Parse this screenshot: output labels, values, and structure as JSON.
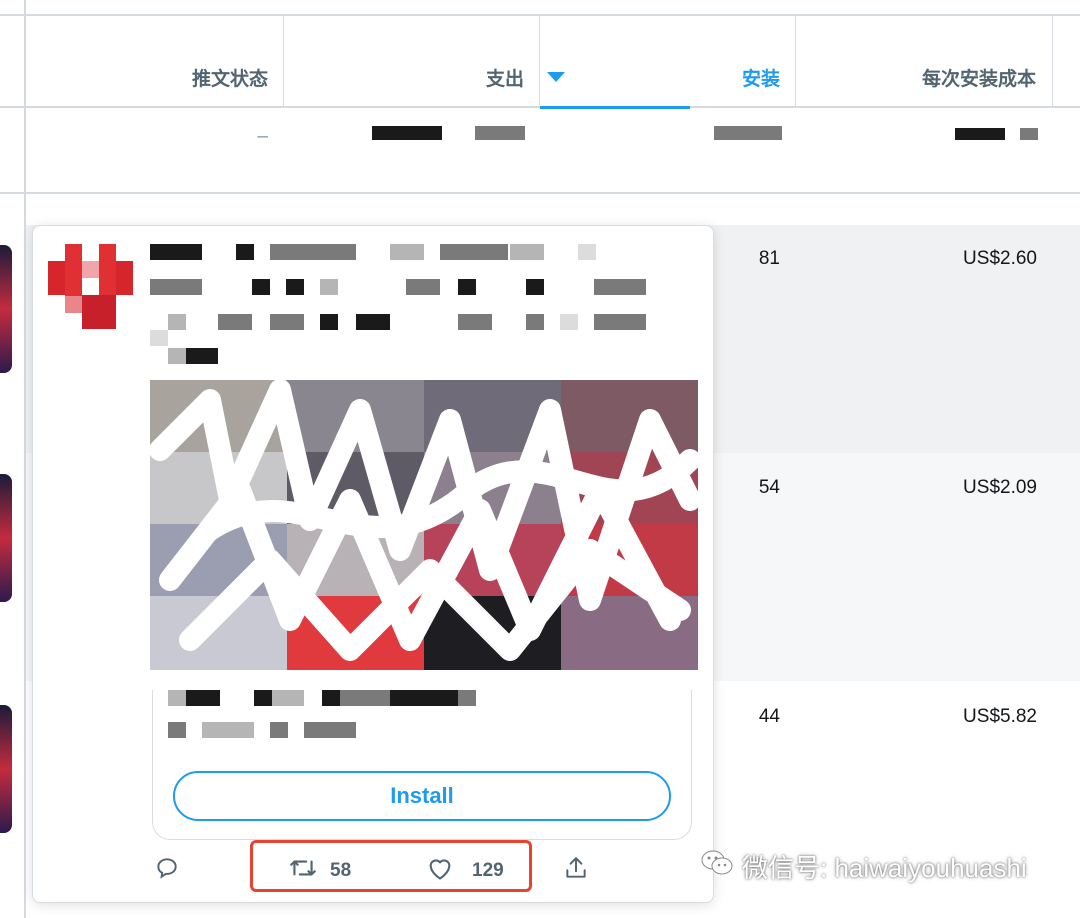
{
  "table": {
    "headers": {
      "tweet_status": "推文状态",
      "spend": "支出",
      "installs": "安装",
      "cost_per_install": "每次安装成本"
    },
    "sort_indicator": "caret-down-icon",
    "summary_row": {
      "tweet_status": "–"
    },
    "rows": [
      {
        "installs": "81",
        "cost_per_install": "US$2.60"
      },
      {
        "installs": "54",
        "cost_per_install": "US$2.09"
      },
      {
        "installs": "44",
        "cost_per_install": "US$5.82"
      }
    ]
  },
  "tweet_card": {
    "install_button": "Install",
    "actions": {
      "reply_icon": "reply-icon",
      "retweet_icon": "retweet-icon",
      "retweet_count": "58",
      "like_icon": "heart-icon",
      "like_count": "129",
      "share_icon": "share-icon"
    }
  },
  "watermark": {
    "text": "微信号: haiwaiyouhuashi",
    "icon": "wechat-icon"
  },
  "colors": {
    "accent": "#1d9bf0",
    "highlight_border": "#e8432e",
    "row_alt_bg": "#f0f2f4"
  }
}
